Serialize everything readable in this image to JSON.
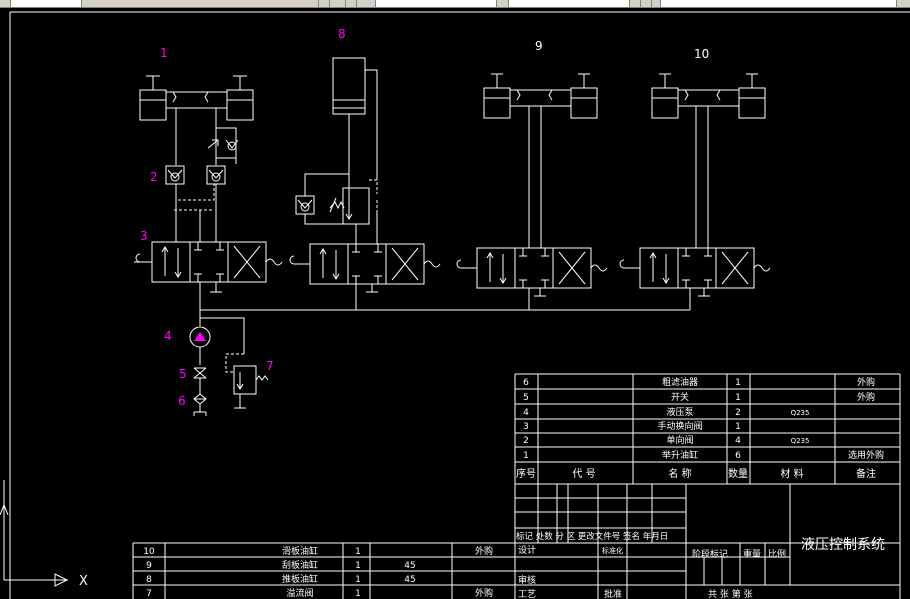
{
  "toolbar": {
    "description": "partial toolbar strip"
  },
  "components": [
    {
      "num": "1",
      "color": "#ff00ff"
    },
    {
      "num": "2",
      "color": "#ff00ff"
    },
    {
      "num": "3",
      "color": "#ff00ff"
    },
    {
      "num": "4",
      "color": "#ff00ff"
    },
    {
      "num": "5",
      "color": "#ff00ff"
    },
    {
      "num": "6",
      "color": "#ff00ff"
    },
    {
      "num": "7",
      "color": "#ff00ff"
    },
    {
      "num": "8",
      "color": "#ff00ff"
    },
    {
      "num": "9",
      "color": "#ffffff"
    },
    {
      "num": "10",
      "color": "#ffffff"
    }
  ],
  "bom_upper": {
    "header": {
      "seq": "序号",
      "code": "代 号",
      "name": "名 称",
      "qty": "数量",
      "material": "材 料",
      "note": "备注"
    },
    "rows": [
      {
        "seq": "6",
        "name": "粗滤油器",
        "qty": "1",
        "material": "",
        "note": "外购"
      },
      {
        "seq": "5",
        "name": "开关",
        "qty": "1",
        "material": "",
        "note": "外购"
      },
      {
        "seq": "4",
        "name": "液压泵",
        "qty": "2",
        "material": "Q235",
        "note": ""
      },
      {
        "seq": "3",
        "name": "手动换向阀",
        "qty": "1",
        "material": "",
        "note": ""
      },
      {
        "seq": "2",
        "name": "单向阀",
        "qty": "4",
        "material": "Q235",
        "note": ""
      },
      {
        "seq": "1",
        "name": "举升油缸",
        "qty": "6",
        "material": "",
        "note": "选用外购"
      }
    ]
  },
  "bom_lower": {
    "rows": [
      {
        "seq": "10",
        "name": "滑板油缸",
        "qty": "1",
        "material": "",
        "note": "外购"
      },
      {
        "seq": "9",
        "name": "刮板油缸",
        "qty": "1",
        "material": "45",
        "note": ""
      },
      {
        "seq": "8",
        "name": "推板油缸",
        "qty": "1",
        "material": "45",
        "note": ""
      },
      {
        "seq": "7",
        "name": "溢流阀",
        "qty": "1",
        "material": "",
        "note": "外购"
      }
    ]
  },
  "title_block": {
    "revision_header": "标记 处数 分 区 更改文件号 签名 年月日",
    "design": "设计",
    "standard": "标准化",
    "review": "审核",
    "process": "工艺",
    "approve": "批准",
    "stage": "阶段标记",
    "weight": "重量",
    "scale": "比例",
    "sheets": "共 张 第 张",
    "title": "液压控制系统"
  },
  "ucs": {
    "x_label": "X"
  }
}
